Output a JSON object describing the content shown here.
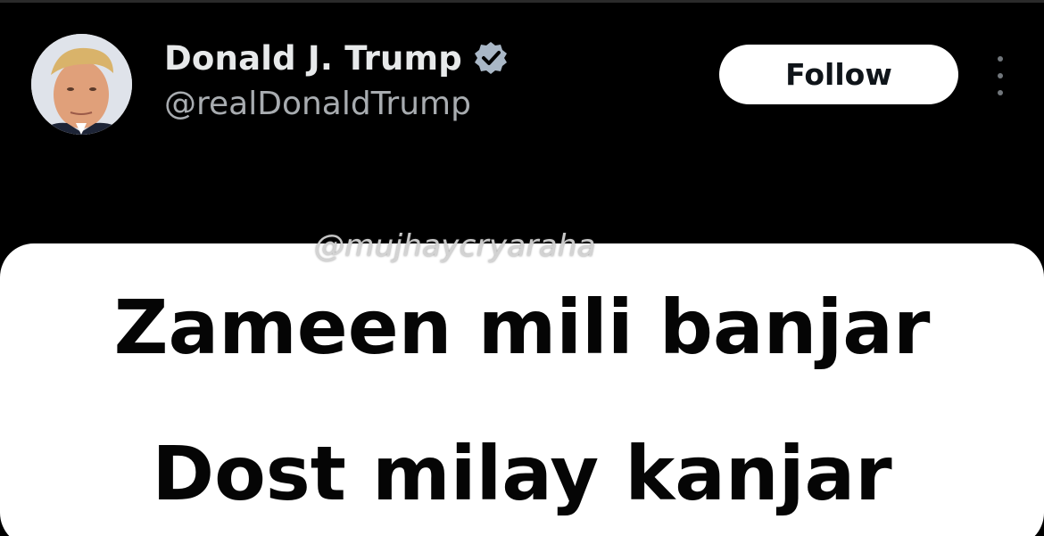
{
  "tweet_header": {
    "display_name": "Donald J. Trump",
    "handle": "@realDonaldTrump",
    "verified_icon": "verified-badge-icon",
    "follow_label": "Follow",
    "more_icon": "more-vertical-icon"
  },
  "watermark": {
    "text": "@mujhaycryaraha"
  },
  "card": {
    "line1": "Zameen mili banjar",
    "line2": "Dost milay kanjar"
  },
  "colors": {
    "background": "#000000",
    "card": "#ffffff",
    "name": "#e7e9ea",
    "handle": "#a8acb0",
    "verified": "#a9b7c6"
  }
}
